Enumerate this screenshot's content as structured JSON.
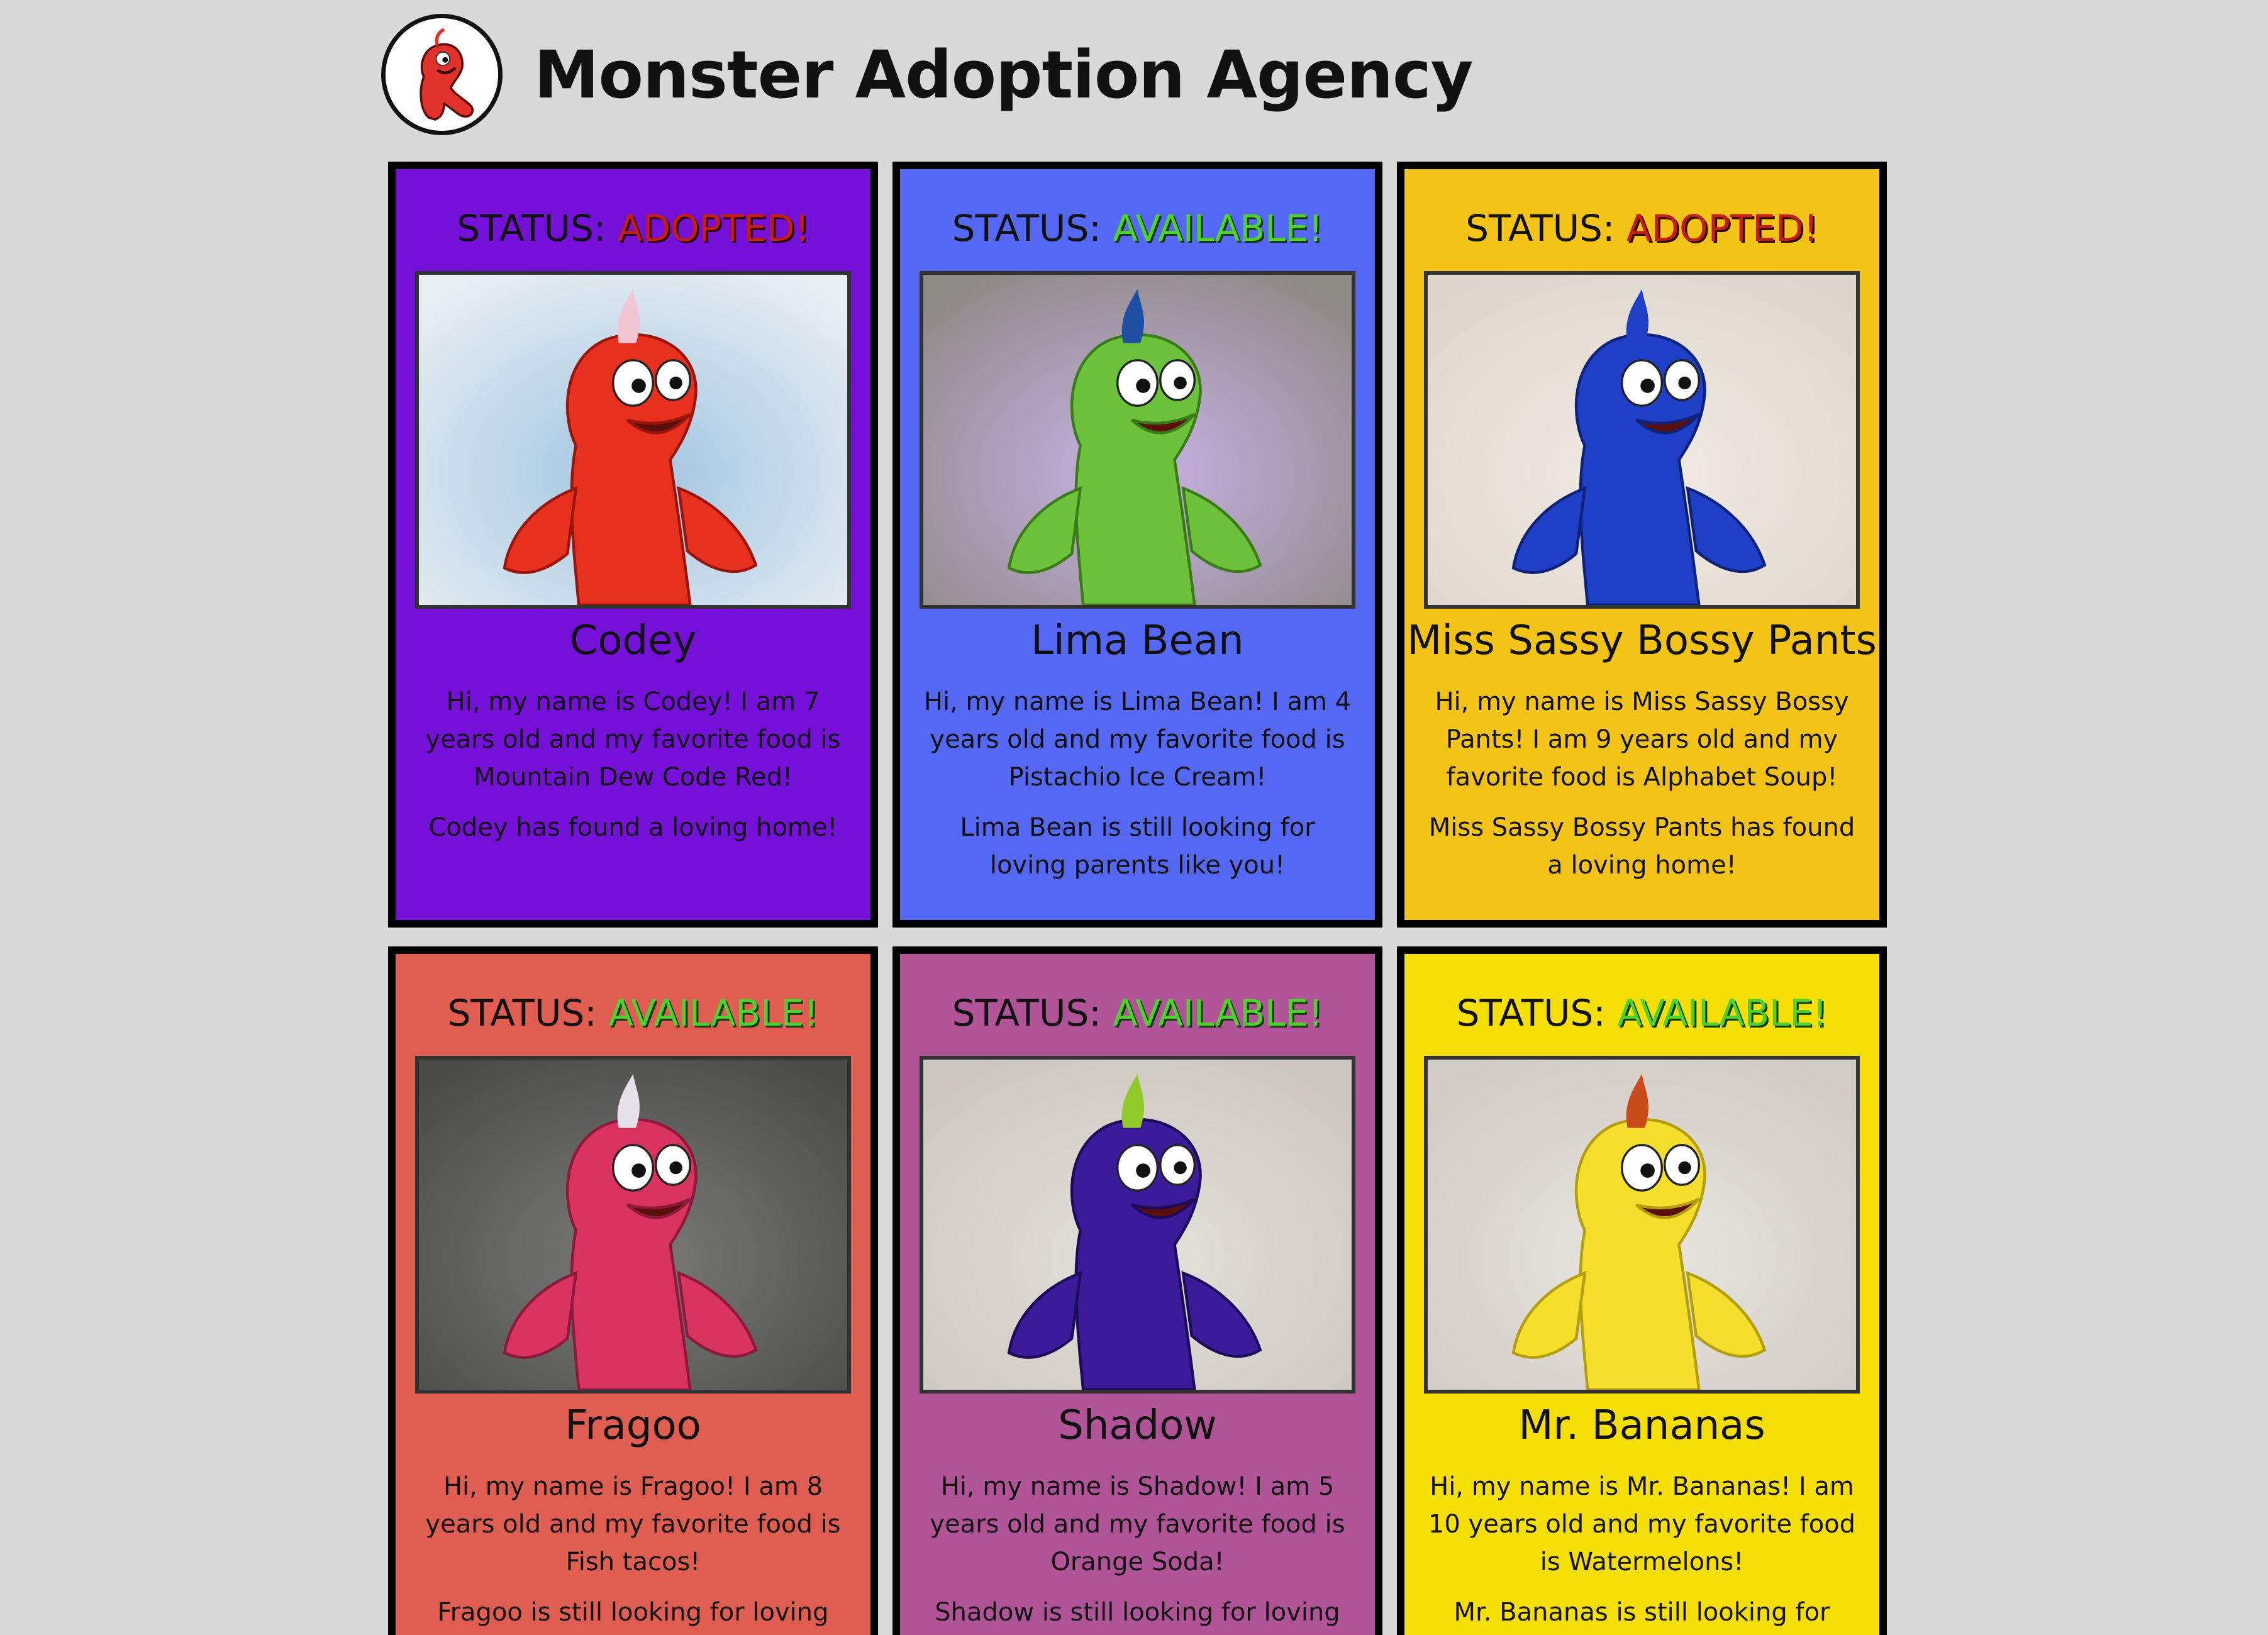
{
  "site": {
    "title": "Monster Adoption Agency",
    "logo_icon": "red-monster-logo"
  },
  "status_prefix": "STATUS:",
  "colors": {
    "background": "#d9d9d9",
    "adopted_text": "#c01f12",
    "available_text": "#4fd12e"
  },
  "monsters": [
    {
      "status": "ADOPTED!",
      "status_type": "adopted",
      "name": "Codey",
      "card_color": "#7510d9",
      "photo_icon": "red-monster-photo",
      "bio": "Hi, my name is Codey! I am 7 years old and my favorite food is Mountain Dew Code Red!",
      "note": "Codey has found a loving home!"
    },
    {
      "status": "AVAILABLE!",
      "status_type": "available",
      "name": "Lima Bean",
      "card_color": "#5468f3",
      "photo_icon": "green-monster-photo",
      "bio": "Hi, my name is Lima Bean! I am 4 years old and my favorite food is Pistachio Ice Cream!",
      "note": "Lima Bean is still looking for loving parents like you!"
    },
    {
      "status": "ADOPTED!",
      "status_type": "adopted",
      "name": "Miss Sassy Bossy Pants",
      "card_color": "#f3c318",
      "photo_icon": "blue-monster-photo",
      "bio": "Hi, my name is Miss Sassy Bossy Pants! I am 9 years old and my favorite food is Alphabet Soup!",
      "note": "Miss Sassy Bossy Pants has found a loving home!"
    },
    {
      "status": "AVAILABLE!",
      "status_type": "available",
      "name": "Fragoo",
      "card_color": "#df5e51",
      "photo_icon": "pink-monster-photo",
      "bio": "Hi, my name is Fragoo! I am 8 years old and my favorite food is Fish tacos!",
      "note": "Fragoo is still looking for loving parents like you!"
    },
    {
      "status": "AVAILABLE!",
      "status_type": "available",
      "name": "Shadow",
      "card_color": "#b15497",
      "photo_icon": "purple-monster-photo",
      "bio": "Hi, my name is Shadow! I am 5 years old and my favorite food is Orange Soda!",
      "note": "Shadow is still looking for loving parents like you!"
    },
    {
      "status": "AVAILABLE!",
      "status_type": "available",
      "name": "Mr. Bananas",
      "card_color": "#f6df06",
      "photo_icon": "yellow-monster-photo",
      "bio": "Hi, my name is Mr. Bananas! I am 10 years old and my favorite food is Watermelons!",
      "note": "Mr. Bananas is still looking for loving parents like you!"
    }
  ]
}
